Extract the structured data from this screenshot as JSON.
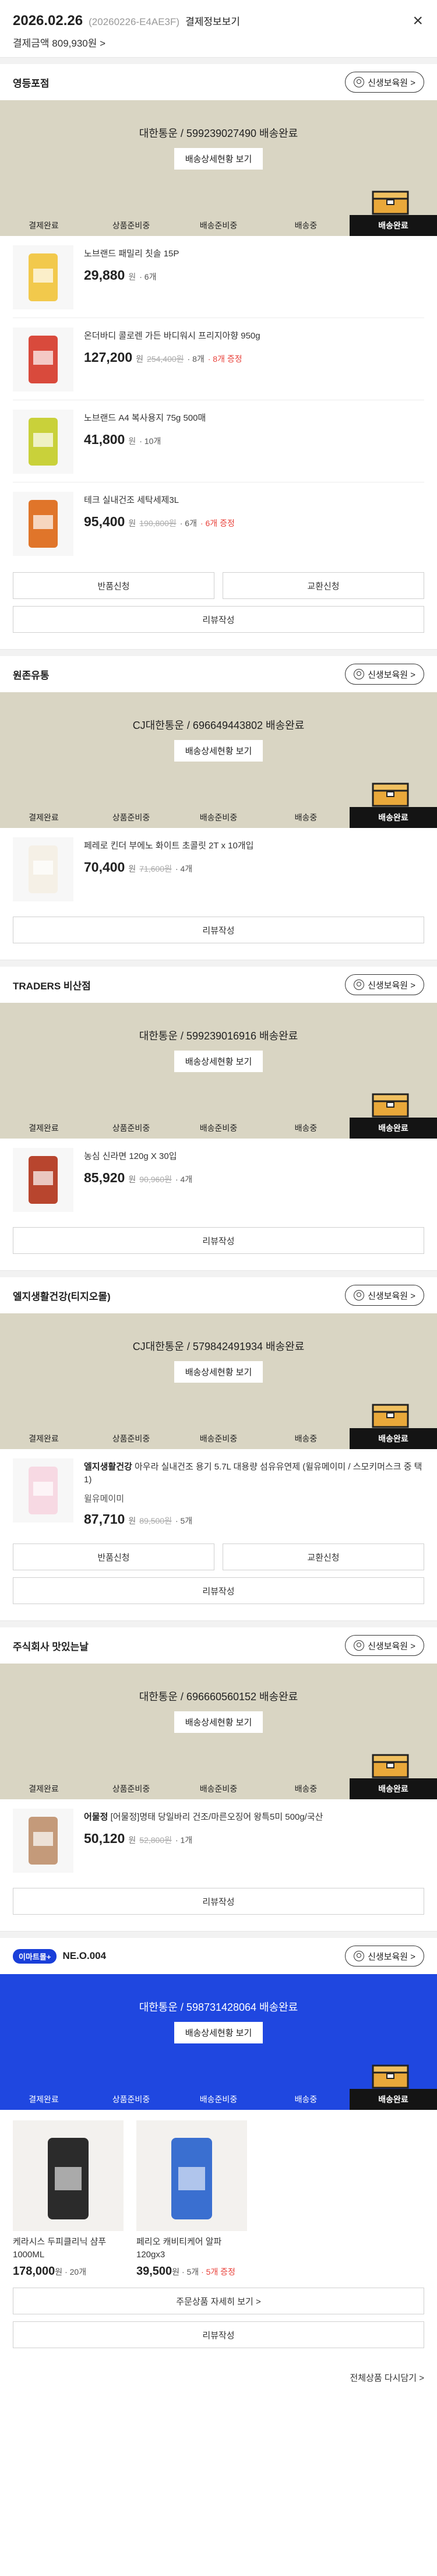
{
  "header": {
    "date": "2026.02.26",
    "order_id": "(20260226-E4AE3F)",
    "detail_link": "결제정보보기",
    "total": "결제금액 809,930원 >",
    "close": "×"
  },
  "common": {
    "delivery_detail": "배송상세현황 보기",
    "review": "리뷰작성",
    "return": "반품신청",
    "exchange": "교환신청",
    "store_link": "신생보육원 >"
  },
  "steps": [
    "결제완료",
    "상품준비중",
    "배송준비중",
    "배송중",
    "배송완료"
  ],
  "stores": [
    {
      "name": "영등포점",
      "status": "대한통운 / 599239027490 배송완료",
      "items": [
        {
          "name": "노브랜드 패밀리 칫솔 15P",
          "price": "29,880",
          "unit": "원",
          "orig": "",
          "qty": "· 6개",
          "gift": "",
          "thumb": "#f2c94c"
        },
        {
          "name": "온더바디 콜로렌 가든 바디워시 프리지아향 950g",
          "price": "127,200",
          "unit": "원",
          "orig": "254,400원",
          "qty": "· 8개",
          "gift": "· 8개 증정",
          "thumb": "#d94a3c"
        },
        {
          "name": "노브랜드 A4 복사용지 75g 500매",
          "price": "41,800",
          "unit": "원",
          "orig": "",
          "qty": "· 10개",
          "gift": "",
          "thumb": "#c9d13a"
        },
        {
          "name": "테크 실내건조 세탁세제3L",
          "price": "95,400",
          "unit": "원",
          "orig": "190,800원",
          "qty": "· 6개",
          "gift": "· 6개 증정",
          "thumb": "#e0752a"
        }
      ]
    },
    {
      "name": "원존유통",
      "status": "CJ대한통운 / 696649443802 배송완료",
      "items": [
        {
          "name": "페레로 킨더 부에노 화이트 초콜릿 2T x 10개입",
          "price": "70,400",
          "unit": "원",
          "orig": "71,600원",
          "qty": "· 4개",
          "gift": "",
          "thumb": "#f5f0e6"
        }
      ]
    },
    {
      "name": "TRADERS 비산점",
      "status": "대한통운 / 599239016916 배송완료",
      "items": [
        {
          "name": "농심 신라면 120g X 30입",
          "price": "85,920",
          "unit": "원",
          "orig": "90,960원",
          "qty": "· 4개",
          "gift": "",
          "thumb": "#b8452e"
        }
      ]
    },
    {
      "name": "엘지생활건강(티지오몰)",
      "status": "CJ대한통운 / 579842491934 배송완료",
      "items": [
        {
          "brand": "엘지생활건강",
          "name": "아우라 실내건조 용기 5.7L 대용량 섬유유연제 (윌유메이미 / 스모키머스크 중 택1)",
          "opt": "윌유메이미",
          "price": "87,710",
          "unit": "원",
          "orig": "89,500원",
          "qty": "· 5개",
          "gift": "",
          "thumb": "#f7d9e3"
        }
      ]
    },
    {
      "name": "주식회사 맛있는날",
      "status": "대한통운 / 696660560152 배송완료",
      "items": [
        {
          "brand": "어물정",
          "name": "[어물정]명태 당일바리 건조/마른오징어 왕특5미 500g/국산",
          "price": "50,120",
          "unit": "원",
          "orig": "52,800원",
          "qty": "· 1개",
          "gift": "",
          "thumb": "#c49a7a"
        }
      ]
    },
    {
      "badge": "이마트몰+",
      "name": "NE.O.004",
      "status": "대한통운 / 598731428064 배송완료",
      "grid": [
        {
          "name": "케라시스 두피클리닉 샴푸 1000ML",
          "price": "178,000",
          "unit": "원",
          "qty": "· 20개",
          "orig": "",
          "gift": "",
          "thumb": "#2b2b2b"
        },
        {
          "name": "페리오 캐비티케어 알파 120gx3",
          "price": "39,500",
          "unit": "원",
          "orig": "",
          "qty": "· 5개",
          "gift": "· 5개 증정",
          "thumb": "#3a6fd0"
        }
      ],
      "more": "주문상품 자세히 보기 >"
    }
  ],
  "footer": {
    "reorder": "전체상품 다시담기 >"
  },
  "colors": {
    "ship_bg": "#d9d5c3",
    "emart_blue": "#1f47e0",
    "gift_red": "#e8413a"
  }
}
